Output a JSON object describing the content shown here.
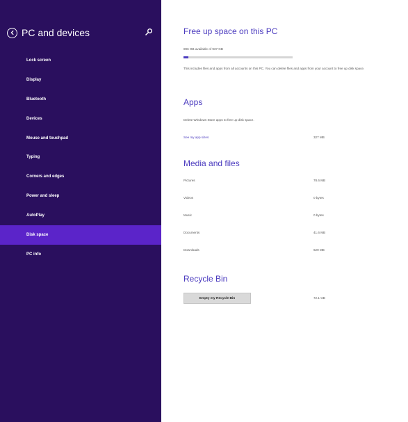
{
  "colors": {
    "sidebar_bg": "#2a0f5e",
    "selected_bg": "#5b24c9",
    "accent": "#4b3bbf"
  },
  "sidebar": {
    "title": "PC and devices",
    "back_icon": "back-arrow-icon",
    "search_icon": "search-icon",
    "items": [
      {
        "label": "Lock screen"
      },
      {
        "label": "Display"
      },
      {
        "label": "Bluetooth"
      },
      {
        "label": "Devices"
      },
      {
        "label": "Mouse and touchpad"
      },
      {
        "label": "Typing"
      },
      {
        "label": "Corners and edges"
      },
      {
        "label": "Power and sleep"
      },
      {
        "label": "AutoPlay"
      },
      {
        "label": "Disk space",
        "selected": true
      },
      {
        "label": "PC info"
      }
    ]
  },
  "main": {
    "free_space": {
      "title": "Free up space on this PC",
      "available": "896 GB available of 937 GB",
      "used_fraction": 0.044,
      "description": "This includes files and apps from all accounts on this PC. You can delete files and apps from your account to free up disk space."
    },
    "apps": {
      "title": "Apps",
      "description": "Delete Windows Store apps to free up disk space.",
      "link": "See my app sizes",
      "size": "327 MB"
    },
    "media": {
      "title": "Media and files",
      "rows": [
        {
          "label": "Pictures",
          "value": "78.6 MB"
        },
        {
          "label": "Videos",
          "value": "0 bytes"
        },
        {
          "label": "Music",
          "value": "0 bytes"
        },
        {
          "label": "Documents",
          "value": "41.6 MB"
        },
        {
          "label": "Downloads",
          "value": "629 MB"
        }
      ]
    },
    "recycle": {
      "title": "Recycle Bin",
      "button": "Empty my Recycle Bin",
      "size": "72.1 GB"
    }
  }
}
